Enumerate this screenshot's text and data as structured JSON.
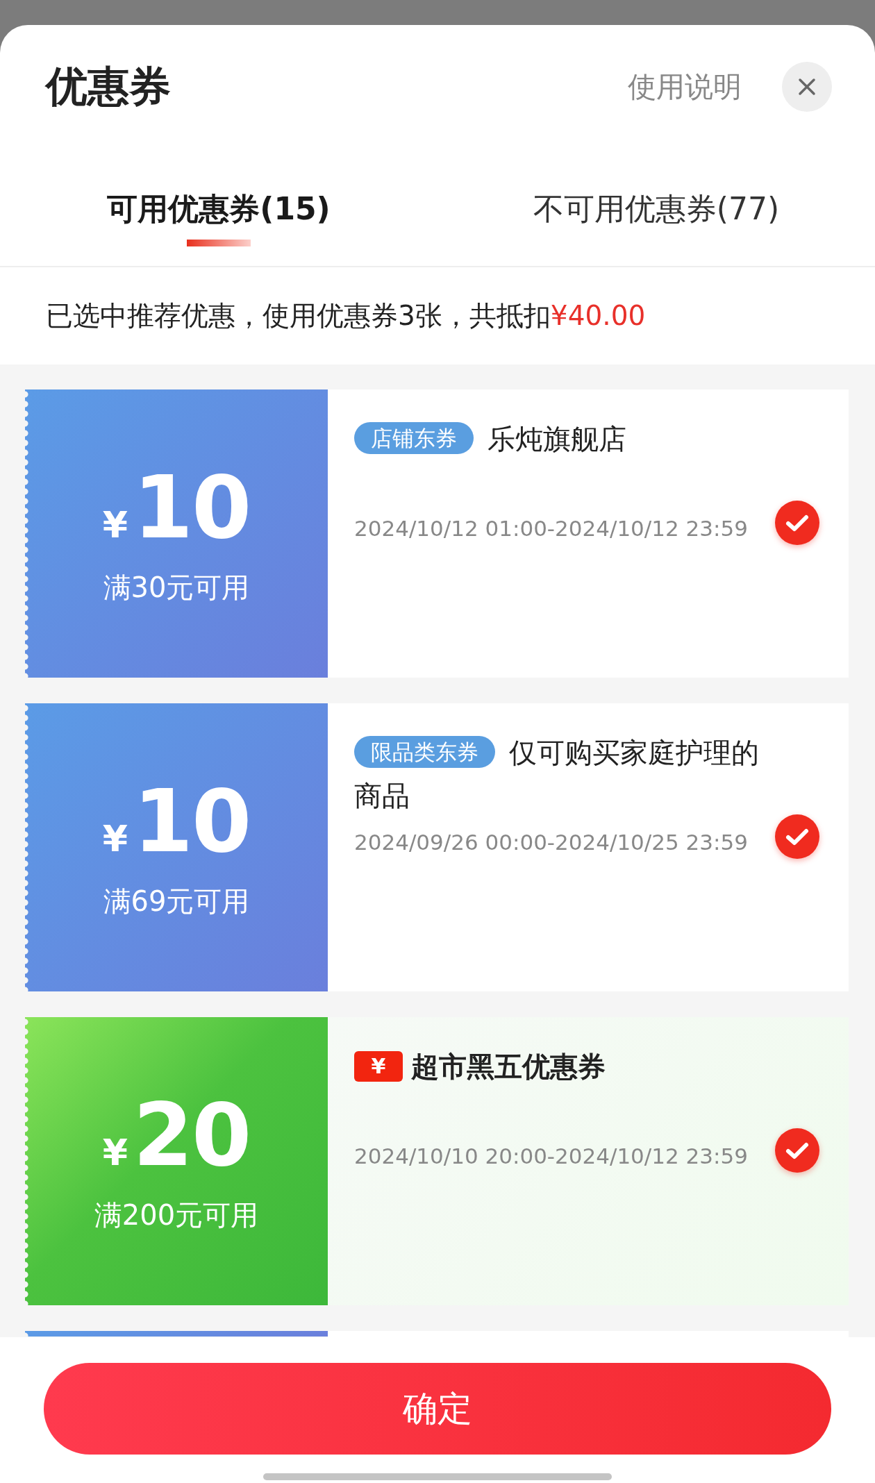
{
  "sheet": {
    "title": "优惠券",
    "help_link": "使用说明"
  },
  "tabs": [
    {
      "label": "可用优惠券(15)",
      "selected": true
    },
    {
      "label": "不可用优惠券(77)",
      "selected": false
    }
  ],
  "summary": {
    "text": "已选中推荐优惠，使用优惠券3张，共抵扣",
    "amount": "¥40.00"
  },
  "coupons": [
    {
      "kind": "store",
      "currency": "¥",
      "amount": "10",
      "condition": "满30元可用",
      "tag": "店铺东券",
      "title_lines": [
        "乐炖旗舰店"
      ],
      "date": "2024/10/12 01:00-2024/10/12 23:59",
      "checked": true
    },
    {
      "kind": "store",
      "currency": "¥",
      "amount": "10",
      "condition": "满69元可用",
      "tag": "限品类东券",
      "title_lines": [
        "仅可购买家庭护理的",
        "商品"
      ],
      "date": "2024/09/26 00:00-2024/10/25 23:59",
      "checked": true
    },
    {
      "kind": "promo",
      "currency": "¥",
      "amount": "20",
      "condition": "满200元可用",
      "tag": "¥",
      "title_lines": [
        "超市黑五优惠券"
      ],
      "date": "2024/10/10 20:00-2024/10/12 23:59",
      "checked": true
    }
  ],
  "next_coupon": {
    "kind": "store"
  },
  "confirm_button": "确定"
}
